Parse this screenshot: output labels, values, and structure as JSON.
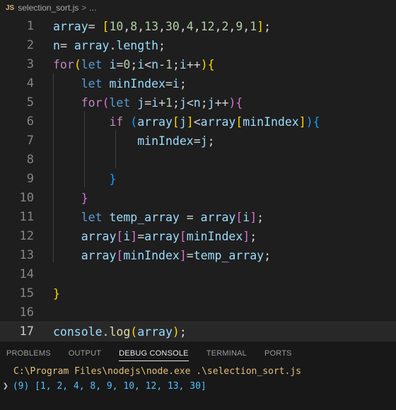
{
  "breadcrumb": {
    "file_icon": "JS",
    "file_name": "selection_sort.js",
    "separator": ">",
    "trail": "..."
  },
  "editor": {
    "line_numbers": [
      "1",
      "2",
      "3",
      "4",
      "5",
      "6",
      "7",
      "8",
      "9",
      "10",
      "11",
      "12",
      "13",
      "14",
      "15",
      "16",
      "17"
    ],
    "current_line": 17,
    "lines": [
      "array= [10,8,13,30,4,12,2,9,1];",
      "n= array.length;",
      "for(let i=0;i<n-1;i++){",
      "    let minIndex=i;",
      "    for(let j=i+1;j<n;j++){",
      "        if (array[j]<array[minIndex]){",
      "            minIndex=j;",
      "",
      "        }",
      "    }",
      "    let temp_array = array[i];",
      "    array[i]=array[minIndex];",
      "    array[minIndex]=temp_array;",
      "",
      "}",
      "",
      "console.log(array);"
    ]
  },
  "panel": {
    "tabs": [
      "PROBLEMS",
      "OUTPUT",
      "DEBUG CONSOLE",
      "TERMINAL",
      "PORTS"
    ],
    "active_tab": "DEBUG CONSOLE",
    "output": {
      "command": "C:\\Program Files\\nodejs\\node.exe .\\selection_sort.js",
      "result": "(9) [1, 2, 4, 8, 9, 10, 12, 13, 30]"
    }
  }
}
